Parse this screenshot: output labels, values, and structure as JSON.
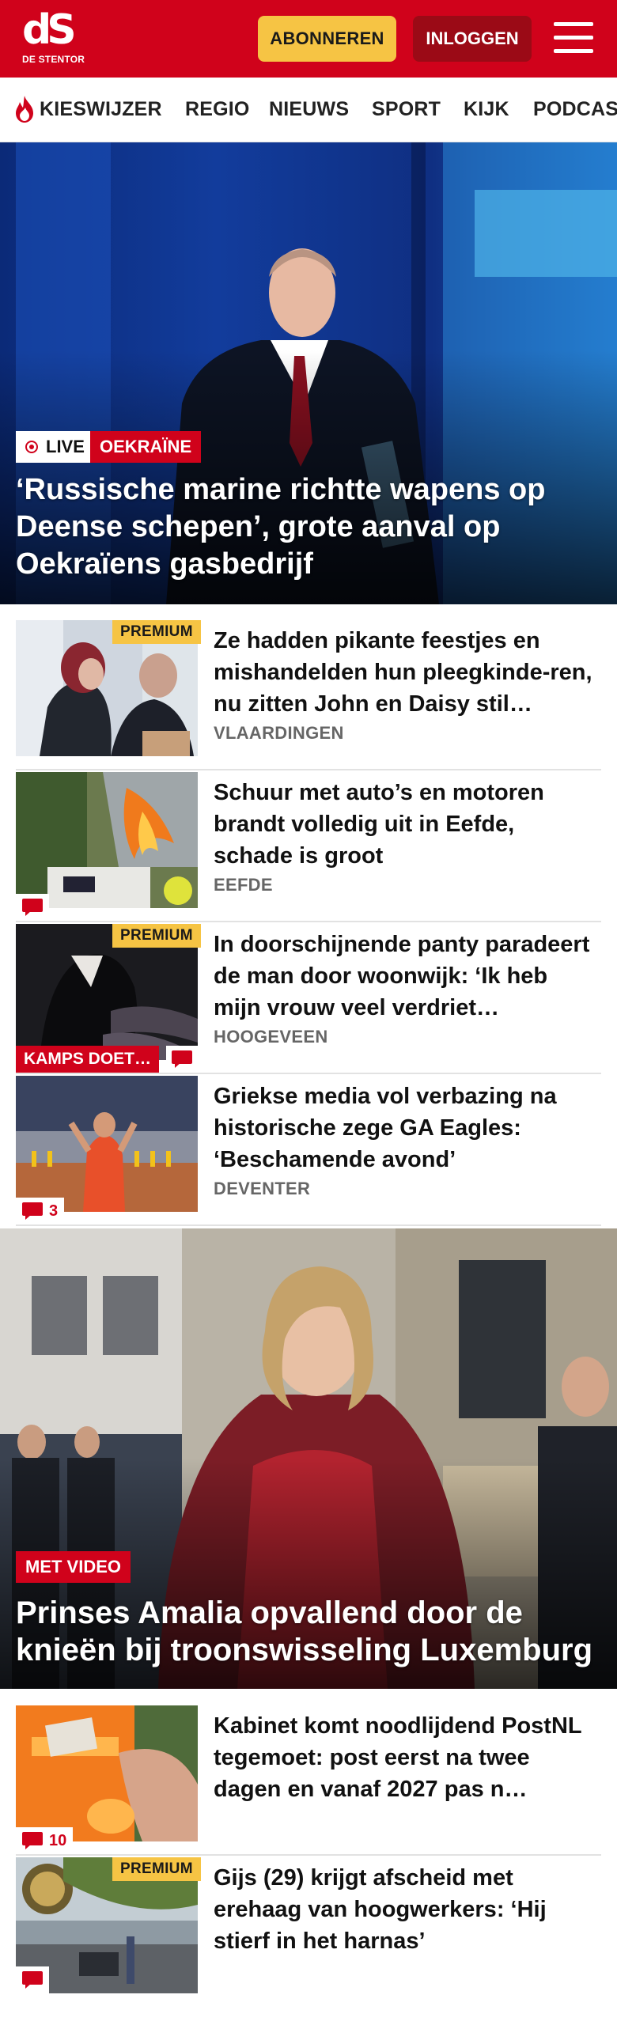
{
  "header": {
    "logo_mark": "dS",
    "logo_sub": "DE STENTOR",
    "subscribe_label": "ABONNEREN",
    "login_label": "INLOGGEN"
  },
  "nav": {
    "items": [
      "KIESWIJZER",
      "REGIO",
      "NIEUWS",
      "SPORT",
      "KIJK",
      "PODCAS"
    ]
  },
  "hero1": {
    "live_label": "LIVE",
    "category": "OEKRAÏNE",
    "title": "‘Russische marine richtte wapens op Deense schepen’, grote aanval op Oekraïens gasbedrijf"
  },
  "articles_a": [
    {
      "title": "Ze hadden pikante feestjes en mishandelden hun pleegkinde-ren, nu zitten John en Daisy stil…",
      "location": "VLAARDINGEN",
      "premium": "PREMIUM"
    },
    {
      "title": "Schuur met auto’s en motoren brandt volledig uit in Eefde, schade is groot",
      "location": "EEFDE"
    },
    {
      "title": "In doorschijnende panty paradeert de man door woonwijk: ‘Ik heb mijn vrouw veel verdriet…",
      "location": "HOOGEVEEN",
      "premium": "PREMIUM",
      "series": "KAMPS DOET…"
    },
    {
      "title": "Griekse media vol verbazing na historische zege GA Eagles: ‘Beschamende avond’",
      "location": "DEVENTER",
      "comments": "3"
    }
  ],
  "hero2": {
    "tag": "MET VIDEO",
    "title": "Prinses Amalia opvallend door de knieën bij troonswisseling Luxemburg"
  },
  "articles_b": [
    {
      "title": "Kabinet komt noodlijdend PostNL tegemoet: post eerst na twee dagen en vanaf 2027 pas n…",
      "comments": "10"
    },
    {
      "title": "Gijs (29) krijgt afscheid met erehaag van hoogwerkers: ‘Hij stierf in het harnas’",
      "premium": "PREMIUM"
    }
  ],
  "colors": {
    "brand_red": "#d0021b",
    "premium_yellow": "#f6c444",
    "login_dark_red": "#9b0a16"
  },
  "icons": [
    "flame-icon",
    "menu-icon",
    "live-dot-icon",
    "comment-icon"
  ]
}
